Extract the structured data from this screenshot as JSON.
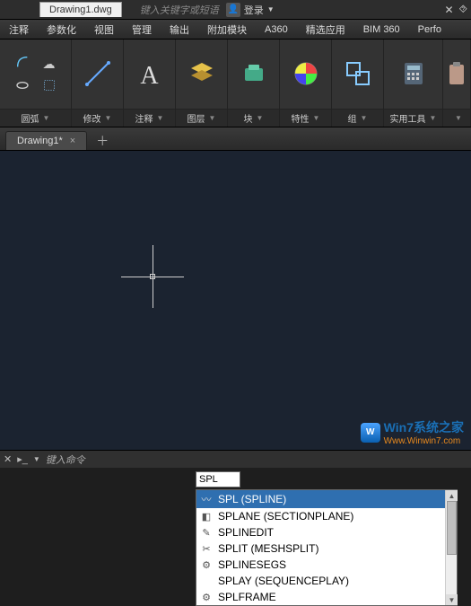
{
  "topbar": {
    "filename": "Drawing1.dwg",
    "search_placeholder": "键入关键字或短语",
    "login_label": "登录"
  },
  "menu": {
    "items": [
      "注释",
      "参数化",
      "视图",
      "管理",
      "输出",
      "附加模块",
      "A360",
      "精选应用",
      "BIM 360",
      "Perfo"
    ]
  },
  "ribbon": {
    "panels": [
      {
        "label": "圆弧"
      },
      {
        "label": "修改"
      },
      {
        "label": "注释"
      },
      {
        "label": "图层"
      },
      {
        "label": "块"
      },
      {
        "label": "特性"
      },
      {
        "label": "组"
      },
      {
        "label": "实用工具"
      },
      {
        "label": ""
      }
    ]
  },
  "doc_tabs": {
    "active": "Drawing1*"
  },
  "command": {
    "typed": "SPL",
    "suggestions": [
      {
        "icon": "spline",
        "text": "SPL (SPLINE)",
        "selected": true
      },
      {
        "icon": "plane",
        "text": "SPLANE (SECTIONPLANE)"
      },
      {
        "icon": "pencil",
        "text": "SPLINEDIT"
      },
      {
        "icon": "split",
        "text": "SPLIT (MESHSPLIT)"
      },
      {
        "icon": "gear",
        "text": "SPLINESEGS"
      },
      {
        "icon": "",
        "text": "SPLAY (SEQUENCEPLAY)"
      },
      {
        "icon": "gear",
        "text": "SPLFRAME"
      }
    ]
  },
  "cmdline": {
    "prompt": "键入命令"
  },
  "watermark": {
    "line1": "Win7系统之家",
    "line2": "Www.Winwin7.com"
  }
}
